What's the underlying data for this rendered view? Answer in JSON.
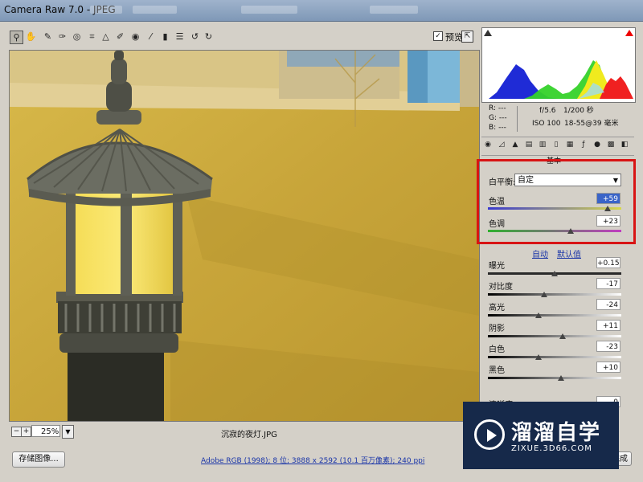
{
  "window": {
    "title": "Camera Raw 7.0 - JPEG"
  },
  "toolbar": {
    "tools": [
      "zoom-icon",
      "hand-icon",
      "white-balance-icon",
      "color-sampler-icon",
      "target-adjust-icon",
      "crop-icon",
      "straighten-icon",
      "spot-removal-icon",
      "red-eye-icon",
      "adjustment-brush-icon",
      "graduated-filter-icon",
      "preferences-icon",
      "rotate-ccw-icon",
      "rotate-cw-icon"
    ],
    "preview_label": "预览",
    "preview_checked": true
  },
  "histogram": {
    "rgb": {
      "r": "R: ---",
      "g": "G: ---",
      "b": "B: ---"
    },
    "exif": {
      "aperture": "f/5.6",
      "shutter": "1/200 秒",
      "iso": "ISO 100",
      "lens": "18-55@39 毫米"
    }
  },
  "panel": {
    "heading": "基本",
    "white_balance": {
      "label": "白平衡:",
      "value": "自定"
    },
    "temperature": {
      "label": "色温",
      "value": "+59",
      "level": 0.9
    },
    "tint": {
      "label": "色调",
      "value": "+23",
      "level": 0.62
    },
    "auto_label": "自动",
    "default_label": "默认值",
    "sliders": [
      {
        "label": "曝光",
        "value": "+0.15",
        "level": 0.5
      },
      {
        "label": "对比度",
        "value": "-17",
        "level": 0.42
      },
      {
        "label": "高光",
        "value": "-24",
        "level": 0.38
      },
      {
        "label": "阴影",
        "value": "+11",
        "level": 0.56
      },
      {
        "label": "白色",
        "value": "-23",
        "level": 0.38
      },
      {
        "label": "黑色",
        "value": "+10",
        "level": 0.55
      }
    ],
    "clarity": {
      "label": "清晰度",
      "value": "0"
    }
  },
  "bottom": {
    "zoom": "25%",
    "filename": "沉寂的夜灯.JPG",
    "save_button": "存储图像...",
    "workflow": "Adobe RGB (1998); 8 位; 3888 x 2592 (10.1 百万像素); 240 ppi",
    "done_button": "完成"
  },
  "watermark": {
    "title": "溜溜自学",
    "url": "ZIXUE.3D66.COM"
  },
  "colors": {
    "highlight_box": "#d81414",
    "link": "#1a35a8"
  }
}
